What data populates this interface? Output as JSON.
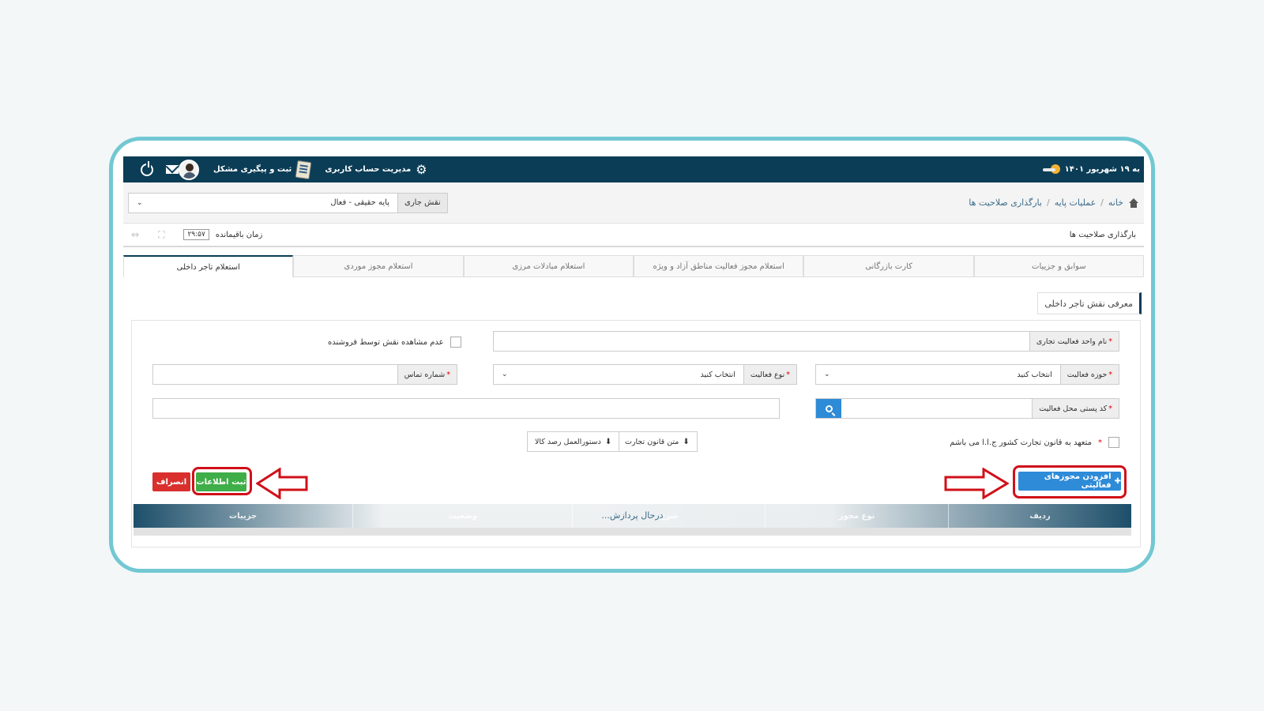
{
  "topbar": {
    "date": "به ۱۹ شهریور ۱۴۰۱",
    "account_management": "مدیریت حساب کاربری",
    "issue_tracking": "ثبت و پیگیری مشکل"
  },
  "breadcrumb": {
    "home": "خانه",
    "base_operations": "عملیات پایه",
    "current": "بارگذاری صلاحیت ها"
  },
  "role": {
    "label": "نقش جاری",
    "value": "پایه حقیقی - فعال"
  },
  "subheader": {
    "page_title": "بارگذاری صلاحیت ها",
    "timer_label": "زمان باقیمانده",
    "timer_value": "۲۹:۵۷"
  },
  "tabs": [
    {
      "label": "سوابق و جزییات"
    },
    {
      "label": "کارت بازرگانی"
    },
    {
      "label": "استعلام مجوز فعالیت مناطق آزاد و ویژه"
    },
    {
      "label": "استعلام مبادلات مرزی"
    },
    {
      "label": "استعلام مجوز موردی"
    },
    {
      "label": "استعلام تاجر داخلی"
    }
  ],
  "section": {
    "title": "معرفی نقش تاجر داخلی"
  },
  "form": {
    "unit_name_label": "نام واحد فعالیت تجاری",
    "hide_role_label": "عدم مشاهده نقش توسط فروشنده",
    "domain_label": "حوزه فعالیت",
    "domain_value": "انتخاب کنید",
    "activity_type_label": "نوع فعالیت",
    "activity_type_value": "انتخاب کنید",
    "phone_label": "شماره تماس",
    "postal_label": "کد پستی محل فعالیت",
    "commit_label": "متعهد به قانون تجارت کشور ج.ا.ا می باشم",
    "trade_law_btn": "متن قانون تجارت",
    "tracking_btn": "دستورالعمل رصد کالا"
  },
  "actions": {
    "add_license": "افزودن مجوزهای فعالیتی",
    "submit": "ثبت اطلاعات",
    "cancel": "انصراف"
  },
  "grid": {
    "columns": [
      "ردیف",
      "نوع مجوز",
      "شرح",
      "وضعیت",
      "جزییات"
    ],
    "status": "درحال پردازش..."
  },
  "colors": {
    "header": "#0b3d56",
    "frame": "#72c8d2",
    "primary": "#2e8bd8",
    "submit": "#3fae49",
    "cancel": "#d9302e",
    "annotation": "#d01019"
  }
}
